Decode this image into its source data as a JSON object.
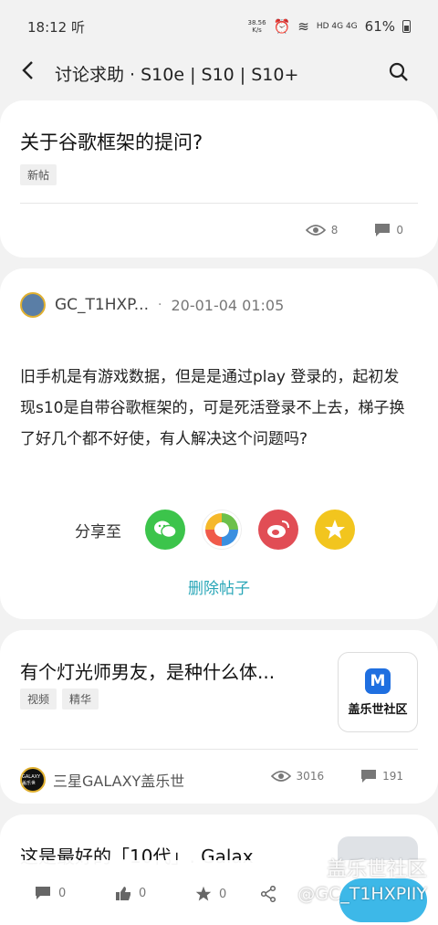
{
  "status_bar": {
    "time": "18:12 听",
    "speed_value": "38.56",
    "speed_unit": "K/s",
    "signal": "HD 4G 4G",
    "battery": "61%"
  },
  "nav": {
    "back_glyph": "‹",
    "title": "讨论求助 · S10e | S10 | S10+"
  },
  "posts": [
    {
      "title": "关于谷歌框架的提问?",
      "tag": "新帖",
      "views": "8",
      "comments": "0"
    },
    {
      "author": "GC_T1HXP...",
      "separator": "·",
      "date": "20-01-04 01:05",
      "body": "旧手机是有游戏数据，但是是通过play  登录的，起初发现s10是自带谷歌框架的，可是死活登录不上去，梯子换了好几个都不好使，有人解决这个问题吗?",
      "share_label": "分享至",
      "share_targets": [
        {
          "name": "wechat",
          "icon": "wechat-icon",
          "color": "#3cc44b"
        },
        {
          "name": "moments",
          "icon": "aperture-icon",
          "color": "#ffffff"
        },
        {
          "name": "weibo",
          "icon": "weibo-icon",
          "color": "#e14d55"
        },
        {
          "name": "qzone",
          "icon": "qzone-icon",
          "color": "#f2c51e"
        }
      ],
      "delete_label": "删除帖子"
    },
    {
      "title": "有个灯光师男友，是种什么体...",
      "tags": [
        "视频",
        "精华"
      ],
      "thumb_brand": "盖乐世社区",
      "thumb_mark": "M",
      "author": "三星GALAXY盖乐世",
      "author_badge": "GALAXY 盖乐世",
      "views": "3016",
      "comments": "191"
    },
    {
      "title": "这是最好的「10代」. Galax"
    }
  ],
  "bottom_bar": {
    "comments": "0",
    "likes": "0",
    "favorites": "0"
  },
  "watermark": {
    "line1": "盖乐世社区",
    "line2": "@GC_T1HXPIIY"
  },
  "colors": {
    "accent": "#2aa7b8",
    "fab": "#3db8e8",
    "background": "#f2f2f2"
  }
}
